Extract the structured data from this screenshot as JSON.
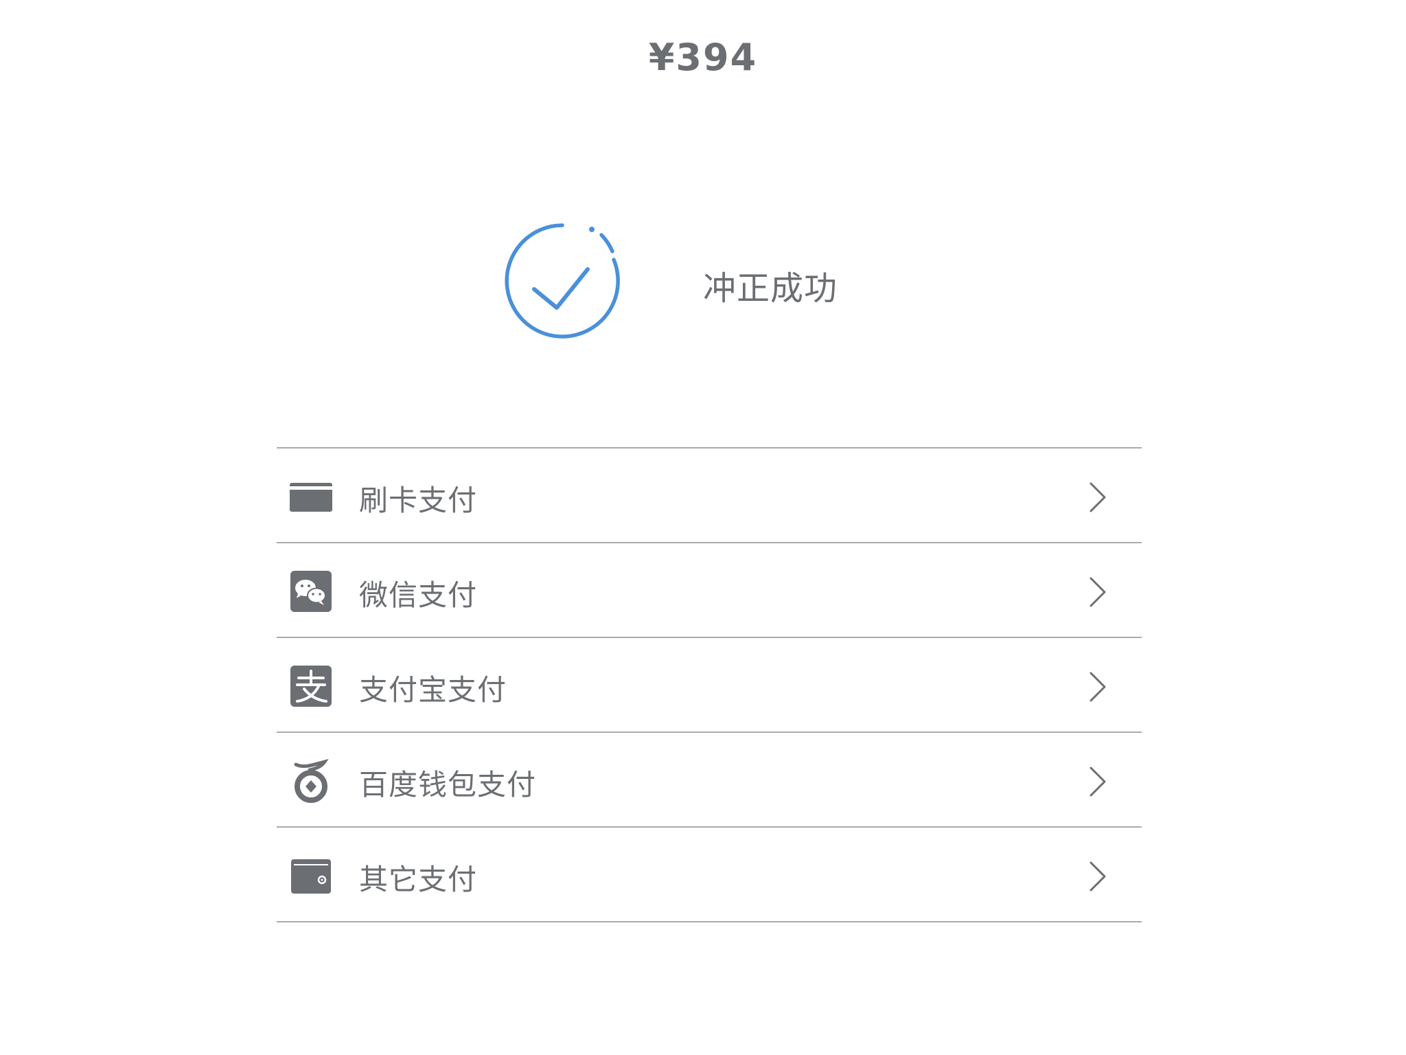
{
  "amount": "¥394",
  "status": {
    "text": "冲正成功",
    "icon": "check-circle-icon",
    "color": "#4a90d9"
  },
  "payment_methods": [
    {
      "label": "刷卡支付",
      "icon": "bank-card-icon"
    },
    {
      "label": "微信支付",
      "icon": "wechat-icon"
    },
    {
      "label": "支付宝支付",
      "icon": "alipay-icon"
    },
    {
      "label": "百度钱包支付",
      "icon": "baidu-wallet-icon"
    },
    {
      "label": "其它支付",
      "icon": "wallet-icon"
    }
  ],
  "colors": {
    "text": "#6b6e72",
    "accent": "#4a90d9",
    "divider": "#a9abad"
  }
}
